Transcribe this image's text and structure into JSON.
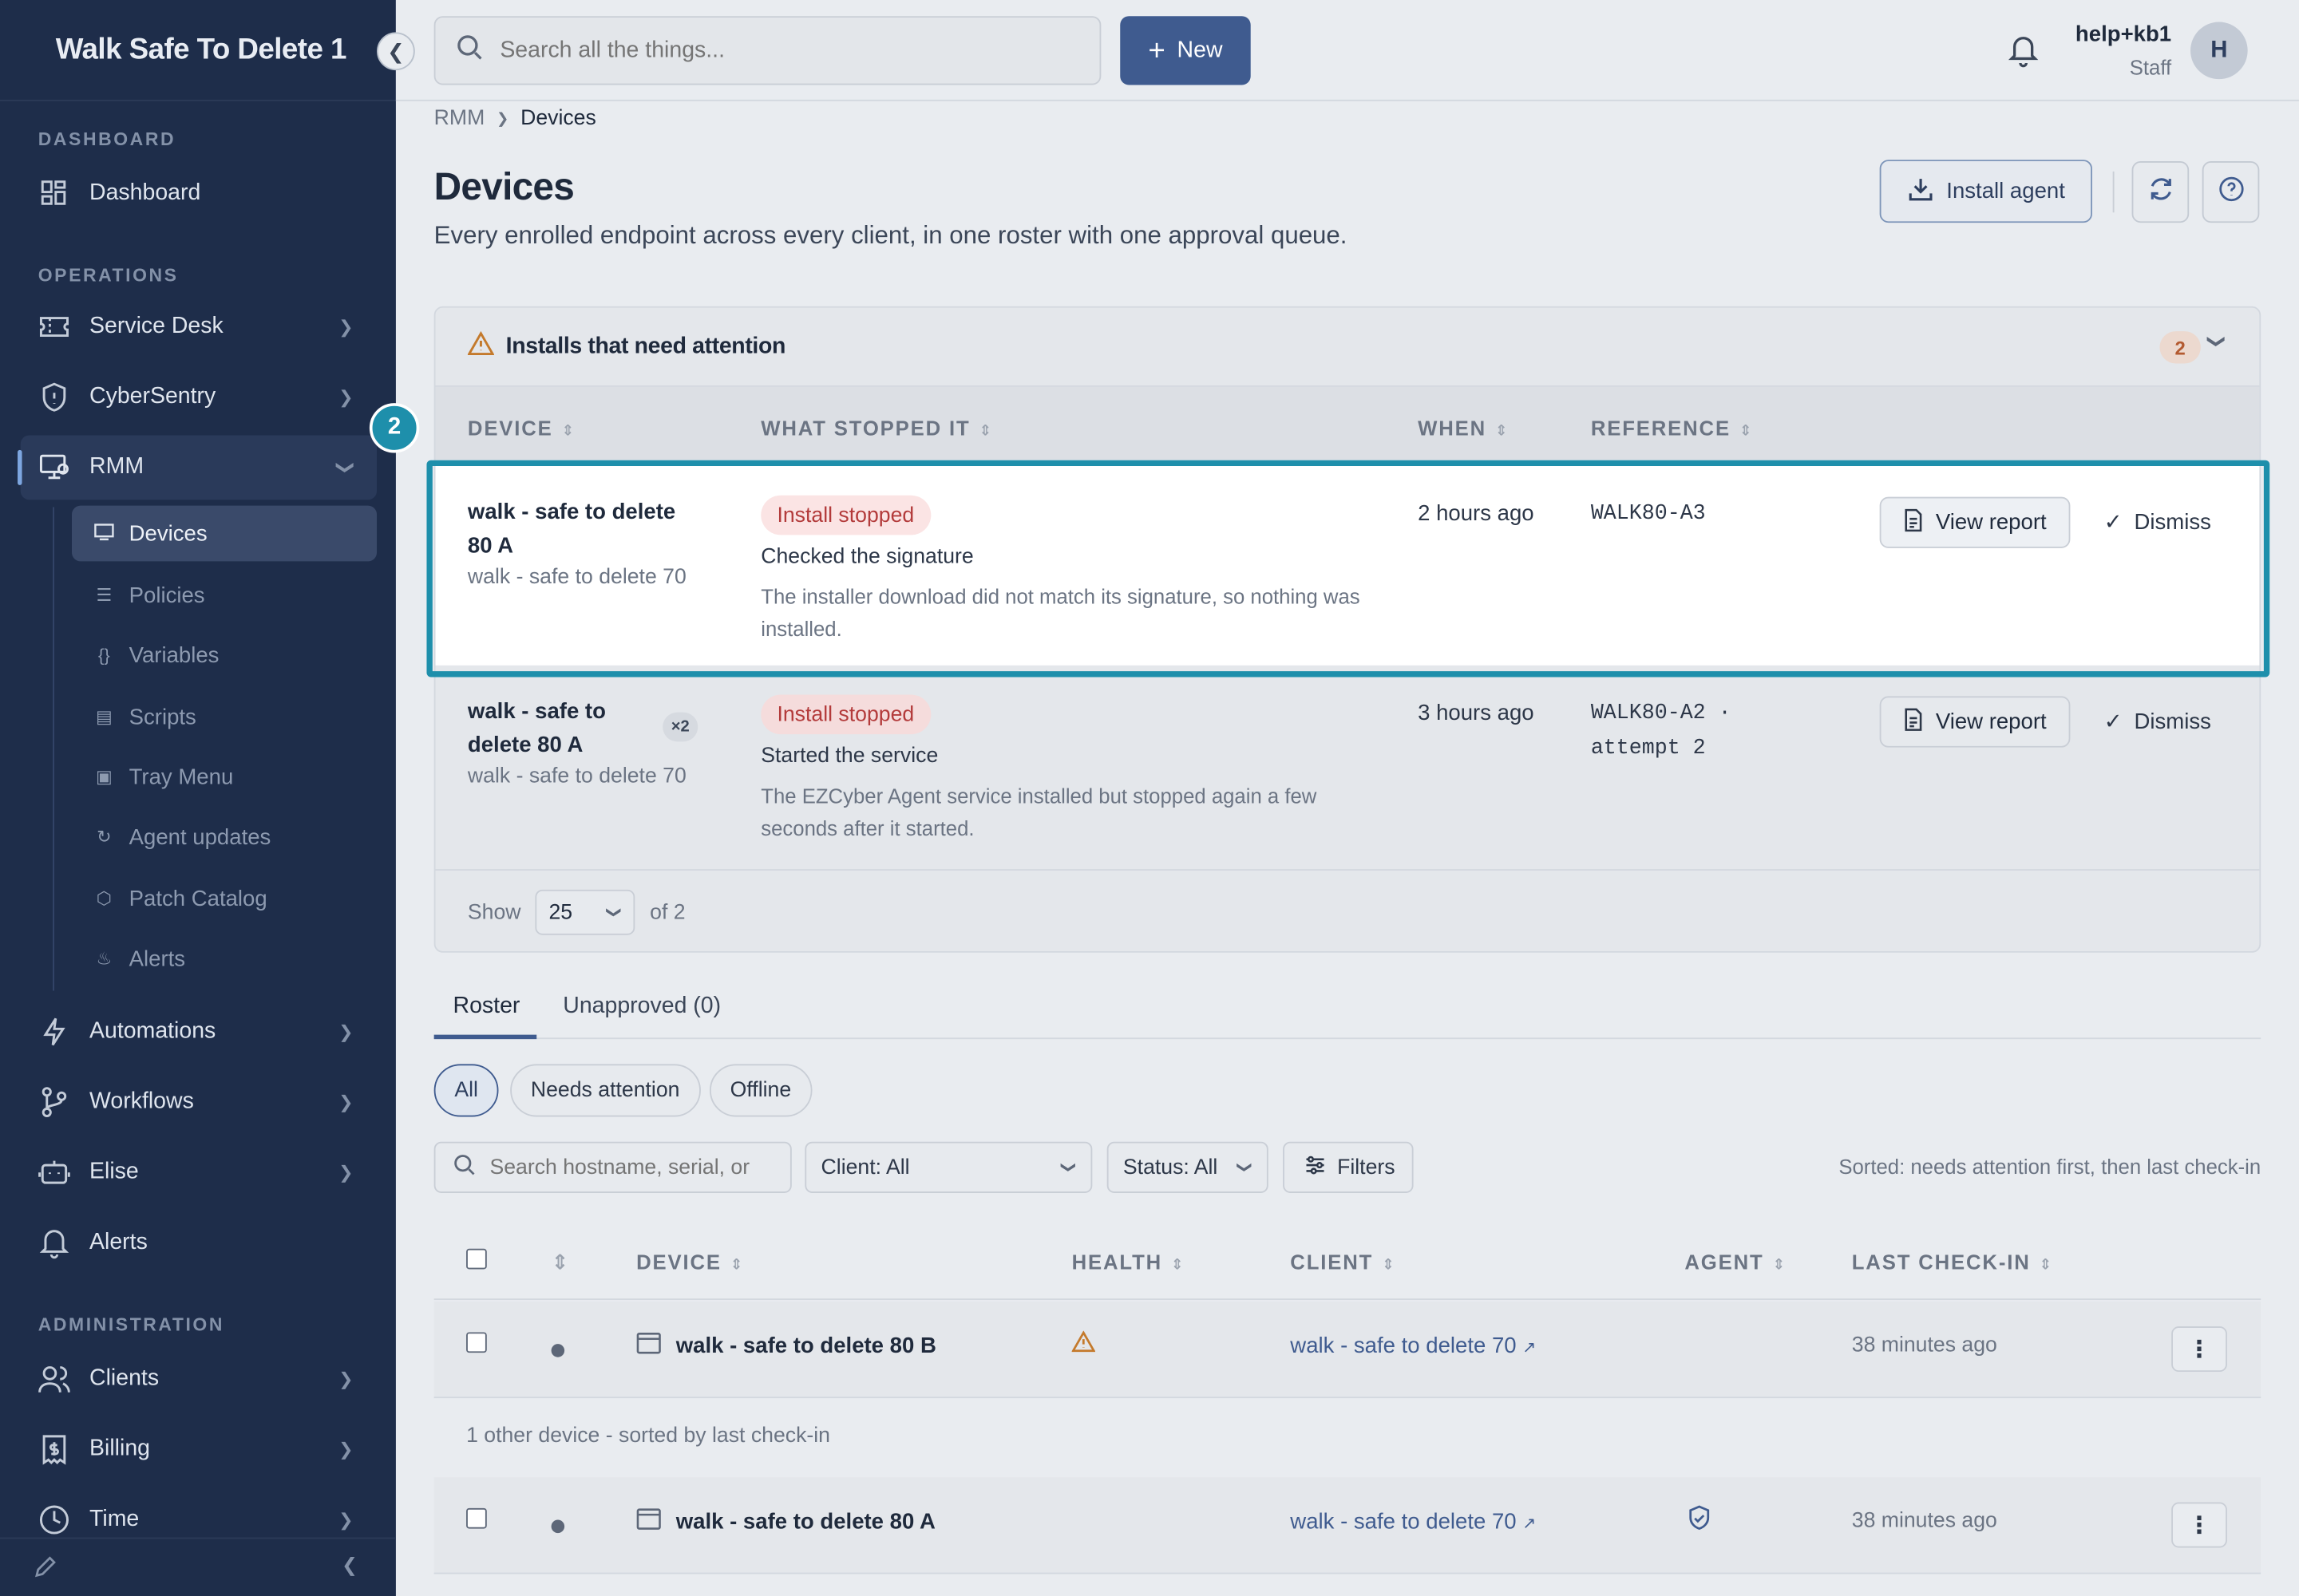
{
  "sidebar": {
    "brand": "Walk Safe To Delete 1",
    "sections": {
      "dashboard": "DASHBOARD",
      "operations": "OPERATIONS",
      "administration": "ADMINISTRATION"
    },
    "items": {
      "dashboard": "Dashboard",
      "service_desk": "Service Desk",
      "cybersentry": "CyberSentry",
      "rmm": "RMM",
      "automations": "Automations",
      "workflows": "Workflows",
      "elise": "Elise",
      "alerts": "Alerts",
      "clients": "Clients",
      "billing": "Billing",
      "time": "Time"
    },
    "rmm_sub": [
      "Devices",
      "Policies",
      "Variables",
      "Scripts",
      "Tray Menu",
      "Agent updates",
      "Patch Catalog",
      "Alerts"
    ]
  },
  "topbar": {
    "search_placeholder": "Search all the things...",
    "new_label": "New",
    "user_name": "help+kb1",
    "user_role": "Staff",
    "avatar_initial": "H"
  },
  "page": {
    "breadcrumb": [
      "RMM",
      "Devices"
    ],
    "title": "Devices",
    "subtitle": "Every enrolled endpoint across every client, in one roster with one approval queue.",
    "install_label": "Install agent"
  },
  "attention": {
    "title": "Installs that need attention",
    "count": "2",
    "step_badge": "2",
    "columns": [
      "DEVICE",
      "WHAT STOPPED IT",
      "WHEN",
      "REFERENCE"
    ],
    "rows": [
      {
        "device": "walk - safe to delete 80 A",
        "client": "walk - safe to delete 70",
        "status": "Install stopped",
        "step": "Checked the signature",
        "detail": "The installer download did not match its signature, so nothing was installed.",
        "when": "2 hours ago",
        "reference": "WALK80-A3",
        "view_label": "View report",
        "dismiss_label": "Dismiss"
      },
      {
        "device": "walk - safe to delete 80 A",
        "multiplier": "×2",
        "client": "walk - safe to delete 70",
        "status": "Install stopped",
        "step": "Started the service",
        "detail": "The EZCyber Agent service installed but stopped again a few seconds after it started.",
        "when": "3 hours ago",
        "reference": "WALK80-A2 · attempt 2",
        "view_label": "View report",
        "dismiss_label": "Dismiss"
      }
    ],
    "footer": {
      "show_label": "Show",
      "page_size": "25",
      "of_label": "of 2"
    }
  },
  "roster": {
    "tabs": [
      "Roster",
      "Unapproved (0)"
    ],
    "chips": [
      "All",
      "Needs attention",
      "Offline"
    ],
    "search_placeholder": "Search hostname, serial, or",
    "client_filter": "Client: All",
    "status_filter": "Status: All",
    "filters_label": "Filters",
    "sorted_note": "Sorted: needs attention first, then last check-in",
    "columns": [
      "DEVICE",
      "HEALTH",
      "CLIENT",
      "AGENT",
      "LAST CHECK-IN"
    ],
    "rows": [
      {
        "device": "walk - safe to delete 80 B",
        "client": "walk - safe to delete 70",
        "last_checkin": "38 minutes ago",
        "health": "warning-icon"
      },
      {
        "device": "walk - safe to delete 80 A",
        "client": "walk - safe to delete 70",
        "last_checkin": "38 minutes ago",
        "agent": "shield-check-icon"
      }
    ],
    "group_label": "1 other device - sorted by last check-in"
  },
  "colors": {
    "sidebar": "#1e2d4a",
    "accent": "#3f5b8f",
    "highlight": "#1e8fab",
    "danger": "#b33b3b"
  }
}
